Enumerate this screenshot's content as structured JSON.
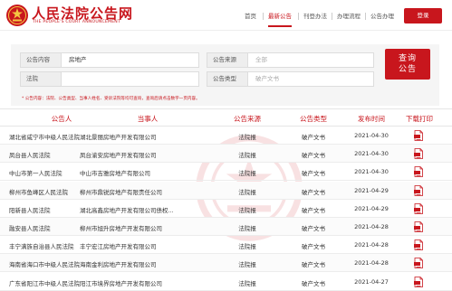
{
  "brand": {
    "title": "人民法院公告网",
    "subtitle": "THE PEOPLE'S COURT ANNOUNCEMENT",
    "accent": "#c8161d"
  },
  "nav": {
    "items": [
      "首页",
      "最新公告",
      "刊登办法",
      "办理流程",
      "公告办理"
    ],
    "active": "最新公告",
    "login": "登录"
  },
  "search": {
    "content_label": "公告内容",
    "content_value": "房地产",
    "source_label": "公告来源",
    "source_value": "全部",
    "court_label": "法院",
    "court_value": "",
    "type_label": "公告类型",
    "type_value": "破产文书",
    "query_label_1": "查询",
    "query_label_2": "公告",
    "hint": "* 公告内容：法院、公告类型、当事人姓名、受诉法院等均可查询，查询后请点击数字一页内容。"
  },
  "table": {
    "headers": [
      "公告人",
      "当事人",
      "公告来源",
      "公告类型",
      "发布时间",
      "下载打印"
    ],
    "rows": [
      [
        "湖北省咸宁市中级人民法院",
        "湖北景丽房地产开发有限公司",
        "法院报",
        "破产文书",
        "2021-04-30"
      ],
      [
        "凤台县人民法院",
        "凤台渝安房地产开发有限公司",
        "法院报",
        "破产文书",
        "2021-04-30"
      ],
      [
        "中山市第一人民法院",
        "中山市吉雅房地产有限公司",
        "法院报",
        "破产文书",
        "2021-04-30"
      ],
      [
        "柳州市鱼峰区人民法院",
        "柳州市鼎锐房地产有限责任公司",
        "法院报",
        "破产文书",
        "2021-04-29"
      ],
      [
        "阳新县人民法院",
        "湖北高鑫房地产开发有限公司债权...",
        "法院报",
        "破产文书",
        "2021-04-29"
      ],
      [
        "融安县人民法院",
        "柳州市旭升房地产开发有限公司",
        "法院报",
        "破产文书",
        "2021-04-28"
      ],
      [
        "丰宁满族自治县人民法院",
        "丰宁宏江房地产开发有限公司",
        "法院报",
        "破产文书",
        "2021-04-28"
      ],
      [
        "海南省海口市中级人民法院",
        "海南金利房地产开发有限公司",
        "法院报",
        "破产文书",
        "2021-04-28"
      ],
      [
        "广东省阳江市中级人民法院",
        "阳江市境界房地产开发有限公司",
        "法院报",
        "破产文书",
        "2021-04-27"
      ]
    ],
    "download_icon": "pdf-icon"
  }
}
